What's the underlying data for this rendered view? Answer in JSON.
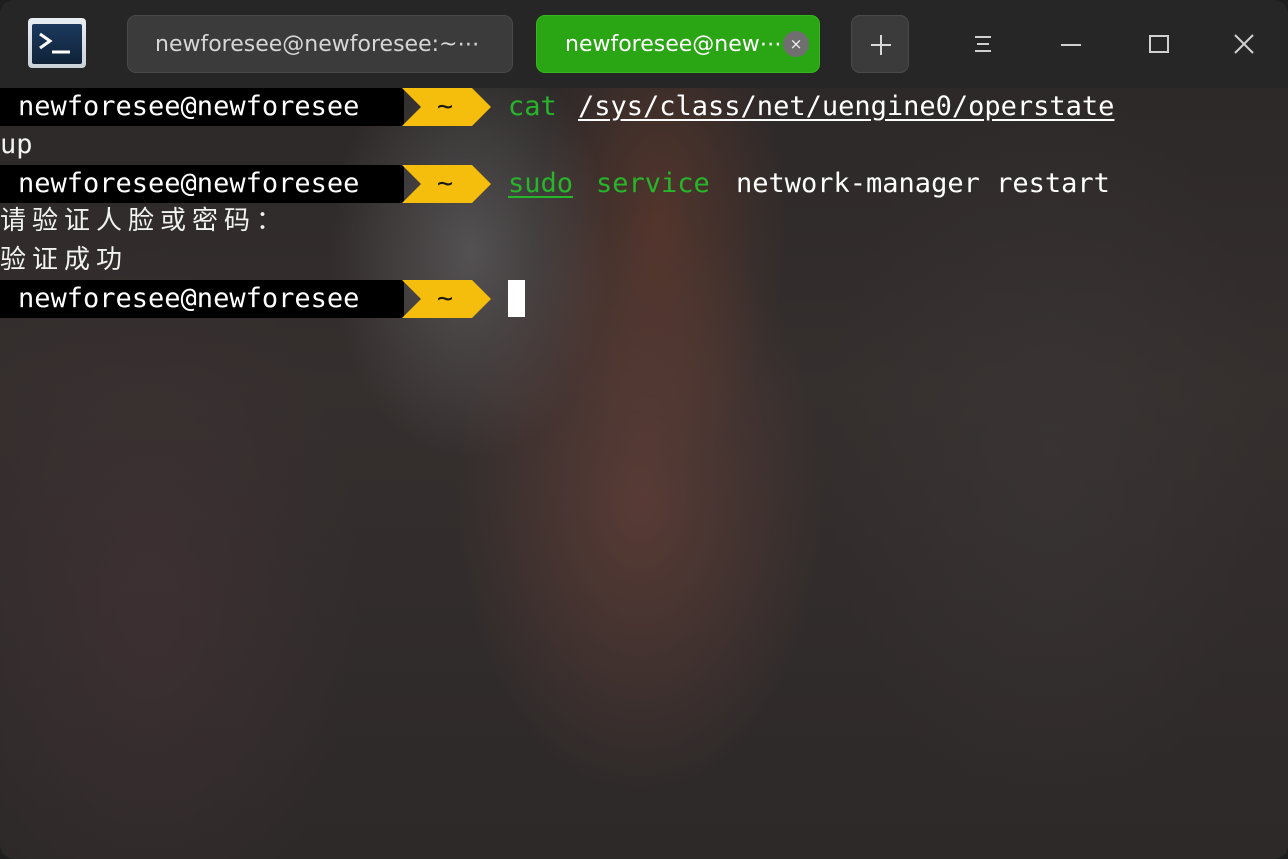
{
  "titlebar": {
    "tabs": [
      {
        "label": "newforesee@newforesee:~⋯",
        "active": false
      },
      {
        "label": "newforesee@new⋯",
        "active": true
      }
    ],
    "close_tab_glyph": "×",
    "icons": {
      "app": "terminal-app-icon",
      "new_tab": "plus-icon",
      "menu": "menu-icon",
      "minimize": "minimize-icon",
      "maximize": "maximize-icon",
      "close": "close-icon"
    },
    "colors": {
      "active_tab": "#2aa514",
      "inactive_tab": "#3b3b3b"
    }
  },
  "terminal": {
    "prompt": {
      "user_host": "newforesee@newforesee",
      "dir": "~",
      "arrow_color": "#f5bd0c"
    },
    "lines": [
      {
        "cmd_word": "cat",
        "cmd_arg": "/sys/class/net/uengine0/operstate",
        "output": "up"
      },
      {
        "cmd_word": "sudo",
        "cmd_word2": "service",
        "cmd_rest": "network-manager restart",
        "output_1": "请验证人脸或密码：",
        "output_2": "验证成功"
      }
    ],
    "command_color": "#27b52a"
  }
}
